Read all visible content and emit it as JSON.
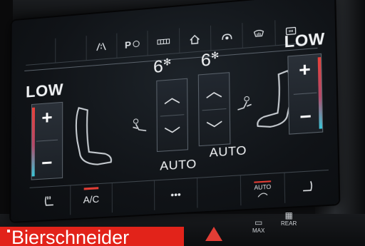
{
  "top_bar": {
    "icons": [
      "blank",
      "blank",
      "lane-assist-icon",
      "parking-icon",
      "seat-heat-bars-icon",
      "home-icon",
      "drive-select-icon",
      "front-defrost-icon",
      "rear-defrost-icon"
    ],
    "parking_label": "P"
  },
  "left_zone": {
    "fan_label": "LOW",
    "temp_plus": "+",
    "temp_minus": "−",
    "fan_level": "6",
    "auto_label": "AUTO"
  },
  "right_zone": {
    "fan_label": "LOW",
    "temp_plus": "+",
    "temp_minus": "−",
    "fan_level": "6",
    "auto_label": "AUTO"
  },
  "glyphs": {
    "fan": "✻",
    "chev_up": "︿",
    "chev_down": "﹀",
    "seat": "🪑",
    "airflow": "⤳",
    "dots": "•••"
  },
  "bottom_bar": {
    "ac_label": "A/C",
    "auto_recirc_label": "AUTO",
    "more_label": "•••"
  },
  "hardware": {
    "max_label": "MAX",
    "rear_label": "REAR"
  },
  "banner": {
    "text": "Bierschneider"
  },
  "colors": {
    "hot": "#e8413a",
    "cold": "#39c6d8",
    "accent_red": "#e23d35",
    "banner_red": "#e2231a"
  }
}
